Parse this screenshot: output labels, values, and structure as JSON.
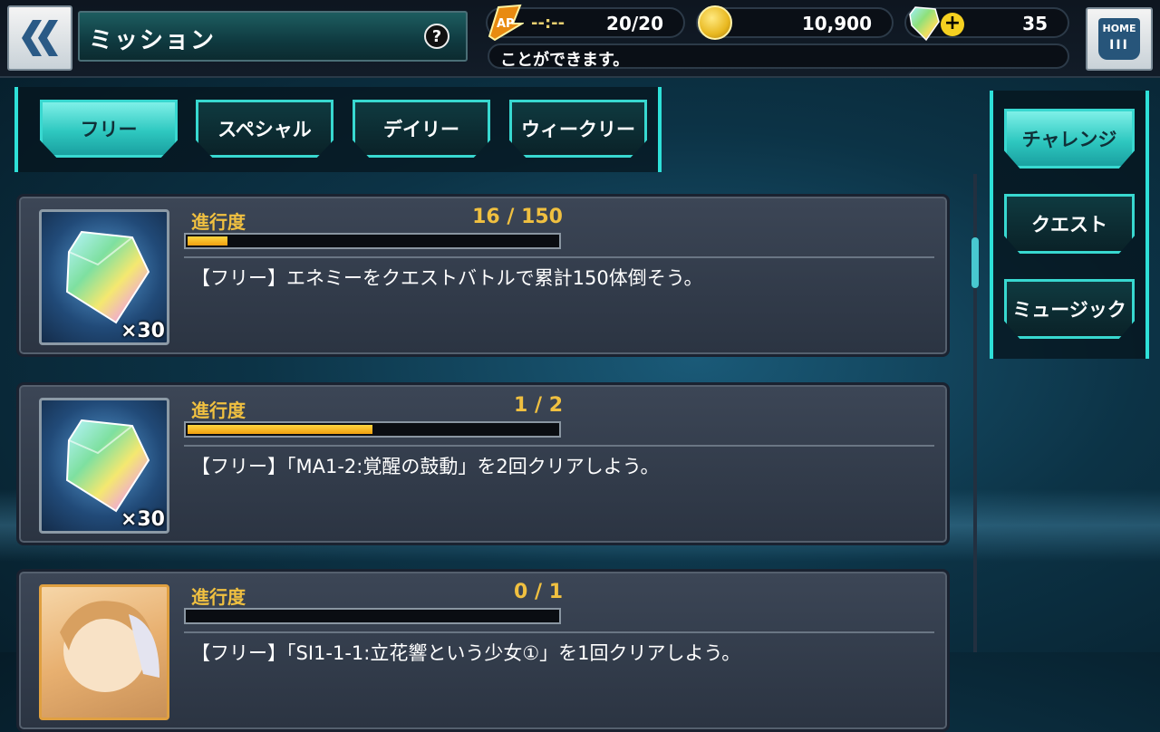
{
  "header": {
    "title": "ミッション",
    "help_label": "?",
    "ap": {
      "timer": "--:--",
      "value": "20/20"
    },
    "coins": "10,900",
    "gems": "35",
    "gems_plus": "+",
    "ticker": "ことができます。",
    "home_label": "HOME",
    "home_bars": "III"
  },
  "tabs": [
    {
      "label": "フリー",
      "active": true
    },
    {
      "label": "スペシャル",
      "active": false
    },
    {
      "label": "デイリー",
      "active": false
    },
    {
      "label": "ウィークリー",
      "active": false
    }
  ],
  "side_menu": [
    {
      "label": "チャレンジ",
      "active": true
    },
    {
      "label": "クエスト",
      "active": false
    },
    {
      "label": "ミュージック",
      "active": false
    }
  ],
  "missions": [
    {
      "progress_label": "進行度",
      "progress_text": "16 / 150",
      "progress_fraction": 0.107,
      "description": "【フリー】エネミーをクエストバトルで累計150体倒そう。",
      "reward_qty": "×30",
      "reward_icon": "gem-icon"
    },
    {
      "progress_label": "進行度",
      "progress_text": "1 / 2",
      "progress_fraction": 0.5,
      "description": "【フリー】「MA1-2:覚醒の鼓動」を2回クリアしよう。",
      "reward_qty": "×30",
      "reward_icon": "gem-icon"
    },
    {
      "progress_label": "進行度",
      "progress_text": "0 / 1",
      "progress_fraction": 0,
      "description": "【フリー】「SI1-1-1:立花響という少女①」を1回クリアしよう。",
      "reward_icon": "character-card-icon"
    }
  ],
  "colors": {
    "accent_cyan": "#38d8d0",
    "progress_gold": "#f0c040",
    "bar_fill": "#f0a010"
  }
}
